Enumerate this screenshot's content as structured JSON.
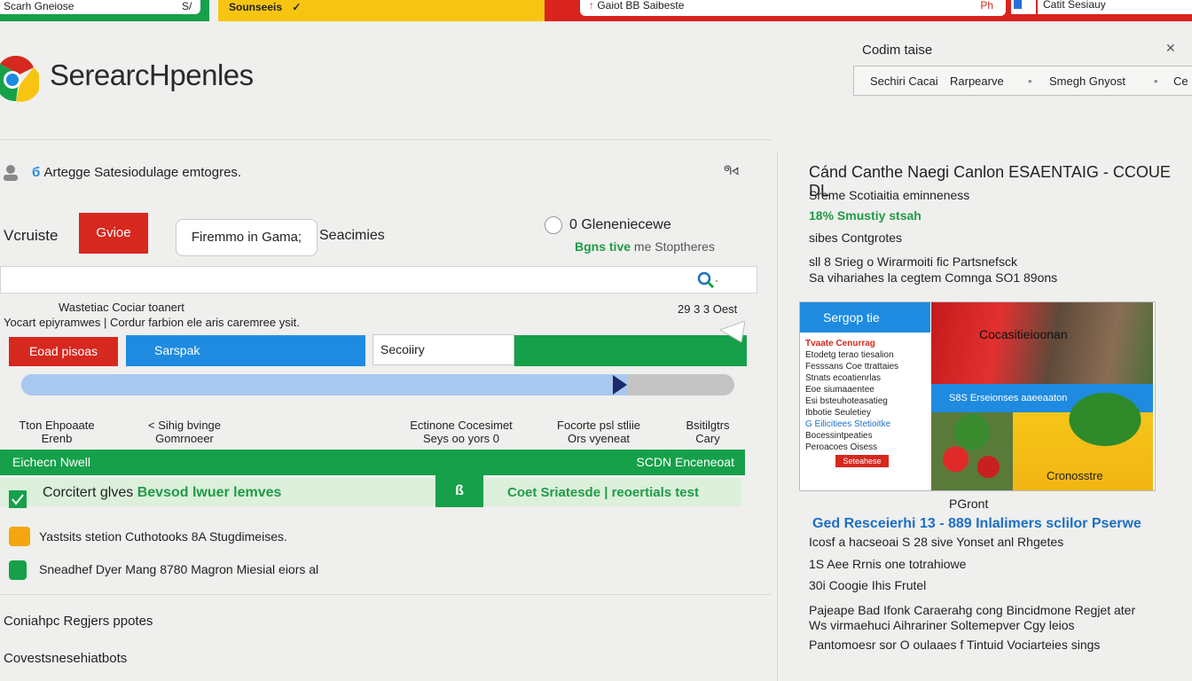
{
  "topbar": {
    "tab1": "Scarh Gneiose",
    "tab1_mark": "S/",
    "tab2": "Sounseeis",
    "tab2_mark": "✓",
    "address": "Gaiot BB Saibeste",
    "address_mark": "Ph",
    "right": "Catit Sesiauy"
  },
  "brand": {
    "name": "SerearcHpenles"
  },
  "right_header": {
    "title": "Codim taise",
    "close": "✕",
    "tabs": [
      "Sechiri Cacai",
      "Rarpearve",
      "Smegh Gnyost",
      "Ce"
    ]
  },
  "row1": {
    "text": "Artegge Satesiodulage emtogres.",
    "right_icon": "ᖗ∢"
  },
  "controls": {
    "label": "Vcruiste",
    "red_button": "Gvioe",
    "pill": "Firemmo in Gama;",
    "searches": "Seacimies",
    "radio_label": "0 Gleneniecewe",
    "green_word": "Bgns tive",
    "green_rest": "me Stoptheres"
  },
  "search": {
    "placeholder": ""
  },
  "info": {
    "line1": "Wastetiac Cociar toanert",
    "line2": "Yocart epiyramwes  |  Cordur farbion ele aris caremree ysit.",
    "right": "29 3 3 Oest"
  },
  "actions": {
    "red": "Eoad pisoas",
    "blue": "Sarspak",
    "box": "Secoiiry"
  },
  "progress": {
    "value": 0.85
  },
  "columns": [
    {
      "l1": "Tton Ehpoaate",
      "l2": "Erenb"
    },
    {
      "l1": "< Sihig bvinge",
      "l2": "Gomrnoeer"
    },
    {
      "l1": "Ectinone Cocesimet",
      "l2": "Seys oo yors 0"
    },
    {
      "l1": "Focorte psl stliie",
      "l2": "Ors vyeneat"
    },
    {
      "l1": "Bsitilgtrs",
      "l2": "Cary"
    }
  ],
  "green_bar": {
    "left": "Eichecn Nwell",
    "right": "SCDN Enceneoat"
  },
  "light_row": {
    "left_a": "Corcitert glves",
    "left_b": "Bevsod lwuer lemves",
    "button": "ß",
    "right": "Coet Sriatesde | reoertials test"
  },
  "bullets": [
    "Yastsits stetion Cuthotooks 8A Stugdimeises.",
    "Sneadhef Dyer Mang 8780 Magron Miesial eiors al"
  ],
  "footer": {
    "line1": "Coniahpc Regjers ppotes",
    "line2": "Covestsnesehiatbots"
  },
  "right_panel": {
    "title": "Cánd Canthe Naegi Canlon ESAENTAIG - CCOUE DL",
    "lines": [
      "Sreme Scotiaitia eminneness",
      "18%  Smustiy stsah",
      "sibes Contgrotes",
      "sll 8 Srieg o Wirarmoiti fic Partsnefsck",
      "Sa vihariahes la cegtem Comnga SO1 89ons"
    ],
    "card": {
      "head": "Sergop tie",
      "list": [
        "Tvaate Cenurrag",
        "Etodetg terao tiesalion",
        "Fesssans Coe ttrattaies",
        "Stnats ecoatienrlas",
        "Eoe siumaaentee",
        "Esi bsteuhoteasatieg",
        "Ibbotie Seuletiey",
        "G Eilicitiees Stetioitke",
        "Bocessintpeaties",
        "Peroacoes Oisess"
      ],
      "red_btn": "Seteahese",
      "photo_label": "Cocasitieioonan",
      "band": "S8S Erseionses aaeeaaton",
      "yellow_label": "Cronosstre"
    },
    "pgnt": "PGront",
    "blue_line": "Ged Resceierhi 13 - 889 Inlalimers sclilor Pserwe",
    "after": [
      "Icosf a hacseoai S          28 sive Yonset anl Rhgetes",
      "1S Aee Rrnis one totrahiowe",
      "30i Coogie Ihis Frutel",
      "Pajeape Bad Ifonk Caraerahg cong Bincidmone Regjet ater",
      "Ws virmaehuci Aihrariner Soltemepver Cgy leios",
      "Pantomoesr sor O oulaaes f Tintuid Vociarteies sings"
    ]
  },
  "colors": {
    "green": "#16a04a",
    "red": "#d6281f",
    "blue": "#1e8be0",
    "yellow": "#f7c511"
  }
}
